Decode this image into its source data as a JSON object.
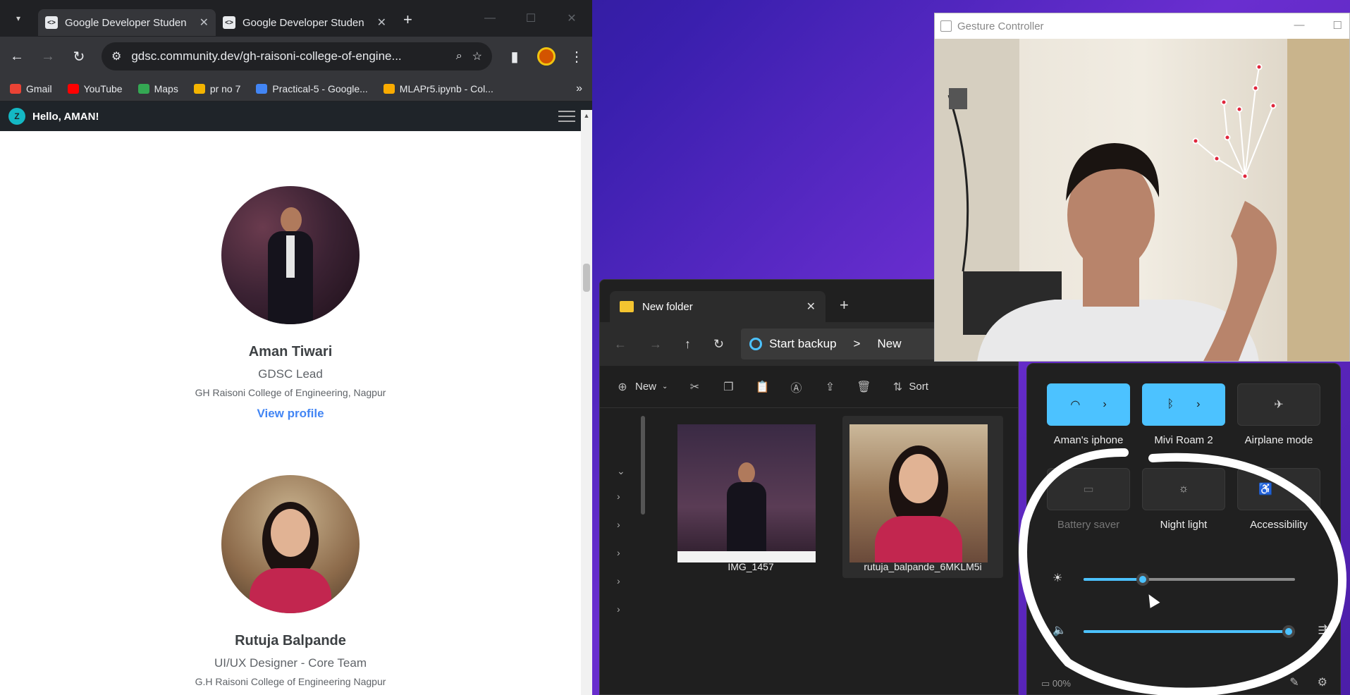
{
  "chrome": {
    "tabs": [
      {
        "title": "Google Developer Studen"
      },
      {
        "title": "Google Developer Studen"
      }
    ],
    "url": "gdsc.community.dev/gh-raisoni-college-of-engine...",
    "bookmarks": [
      {
        "label": "Gmail",
        "color": "#ea4335"
      },
      {
        "label": "YouTube",
        "color": "#ff0000"
      },
      {
        "label": "Maps",
        "color": "#34a853"
      },
      {
        "label": "pr no 7",
        "color": "#f4b400"
      },
      {
        "label": "Practical-5 - Google...",
        "color": "#4285f4"
      },
      {
        "label": "MLAPr5.ipynb - Col...",
        "color": "#f9ab00"
      }
    ],
    "site_greeting": "Hello, AMAN!",
    "members": [
      {
        "name": "Aman Tiwari",
        "role": "GDSC Lead",
        "college": "GH Raisoni College of Engineering, Nagpur",
        "link": "View profile"
      },
      {
        "name": "Rutuja Balpande",
        "role": "UI/UX Designer - Core Team",
        "college": "G.H Raisoni College of Engineering Nagpur"
      }
    ]
  },
  "explorer": {
    "tab_title": "New folder",
    "address": [
      "Start backup",
      ">",
      "New"
    ],
    "new_label": "New",
    "sort_label": "Sort",
    "files": [
      {
        "name": "IMG_1457",
        "selected": false
      },
      {
        "name": "rutuja_balpande_6MKLM5i",
        "selected": true
      }
    ]
  },
  "gesture": {
    "title": "Gesture Controller"
  },
  "quick_settings": {
    "tiles": [
      {
        "label": "Aman's iphone",
        "state": "on",
        "icon": "wifi-icon"
      },
      {
        "label": "Mivi Roam 2",
        "state": "on",
        "icon": "bluetooth-icon"
      },
      {
        "label": "Airplane mode",
        "state": "off",
        "icon": "airplane-icon"
      },
      {
        "label": "Battery saver",
        "state": "disabled",
        "icon": "battery-icon"
      },
      {
        "label": "Night light",
        "state": "off",
        "icon": "night-light-icon"
      },
      {
        "label": "Accessibility",
        "state": "off",
        "icon": "accessibility-icon"
      }
    ],
    "brightness": 0.28,
    "volume": 0.97,
    "battery_text": "00%",
    "accent": "#4cc2ff"
  }
}
